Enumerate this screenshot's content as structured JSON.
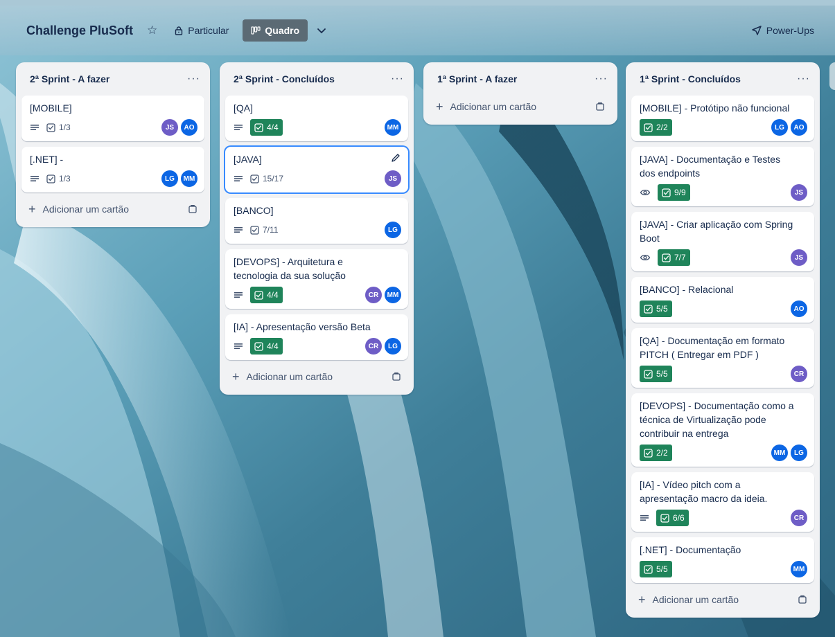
{
  "header": {
    "board_title": "Challenge PluSoft",
    "visibility_label": "Particular",
    "view_label": "Quadro",
    "powerups_label": "Power-Ups"
  },
  "add_card_label": "Adicionar um cartão",
  "colors": {
    "done_badge": "#1f845a",
    "avatar_JS": "#6e5dc6",
    "avatar_AO": "#0c66e4",
    "avatar_LG": "#0c66e4",
    "avatar_MM": "#0c66e4",
    "avatar_CR": "#6e5dc6",
    "focus": "#388bff"
  },
  "lists": [
    {
      "title": "2ª Sprint - A fazer",
      "cards": [
        {
          "title": "[MOBILE]",
          "description": true,
          "watch": false,
          "checklist": "1/3",
          "done": false,
          "members": [
            "JS",
            "AO"
          ]
        },
        {
          "title": "[.NET] -",
          "description": true,
          "watch": false,
          "checklist": "1/3",
          "done": false,
          "members": [
            "LG",
            "MM"
          ]
        }
      ]
    },
    {
      "title": "2ª Sprint - Concluídos",
      "cards": [
        {
          "title": "[QA]",
          "description": true,
          "watch": false,
          "checklist": "4/4",
          "done": true,
          "members": [
            "MM"
          ]
        },
        {
          "title": "[JAVA]",
          "description": true,
          "watch": false,
          "checklist": "15/17",
          "done": false,
          "members": [
            "JS"
          ],
          "focused": true
        },
        {
          "title": "[BANCO]",
          "description": true,
          "watch": false,
          "checklist": "7/11",
          "done": false,
          "members": [
            "LG"
          ]
        },
        {
          "title": "[DEVOPS] - Arquitetura e tecnologia da sua solução",
          "description": true,
          "watch": false,
          "checklist": "4/4",
          "done": true,
          "members": [
            "CR",
            "MM"
          ]
        },
        {
          "title": "[IA] - Apresentação versão Beta",
          "description": true,
          "watch": false,
          "checklist": "4/4",
          "done": true,
          "members": [
            "CR",
            "LG"
          ]
        }
      ]
    },
    {
      "title": "1ª Sprint - A fazer",
      "cards": []
    },
    {
      "title": "1ª Sprint - Concluídos",
      "cards": [
        {
          "title": "[MOBILE] - Protótipo não funcional",
          "description": false,
          "watch": false,
          "checklist": "2/2",
          "done": true,
          "members": [
            "LG",
            "AO"
          ]
        },
        {
          "title": "[JAVA] - Documentação e Testes dos endpoints",
          "description": false,
          "watch": true,
          "checklist": "9/9",
          "done": true,
          "members": [
            "JS"
          ]
        },
        {
          "title": "[JAVA] - Criar aplicação com Spring Boot",
          "description": false,
          "watch": true,
          "checklist": "7/7",
          "done": true,
          "members": [
            "JS"
          ]
        },
        {
          "title": "[BANCO] - Relacional",
          "description": false,
          "watch": false,
          "checklist": "5/5",
          "done": true,
          "members": [
            "AO"
          ]
        },
        {
          "title": "[QA] - Documentação em formato PITCH ( Entregar em PDF )",
          "description": false,
          "watch": false,
          "checklist": "5/5",
          "done": true,
          "members": [
            "CR"
          ]
        },
        {
          "title": "[DEVOPS] - Documentação como a técnica de Virtualização pode contribuir na entrega",
          "description": false,
          "watch": false,
          "checklist": "2/2",
          "done": true,
          "members": [
            "MM",
            "LG"
          ]
        },
        {
          "title": "[IA] - Vídeo pitch com a apresentação macro da ideia.",
          "description": true,
          "watch": false,
          "checklist": "6/6",
          "done": true,
          "members": [
            "CR"
          ]
        },
        {
          "title": "[.NET] - Documentação",
          "description": false,
          "watch": false,
          "checklist": "5/5",
          "done": true,
          "members": [
            "MM"
          ]
        }
      ]
    }
  ]
}
